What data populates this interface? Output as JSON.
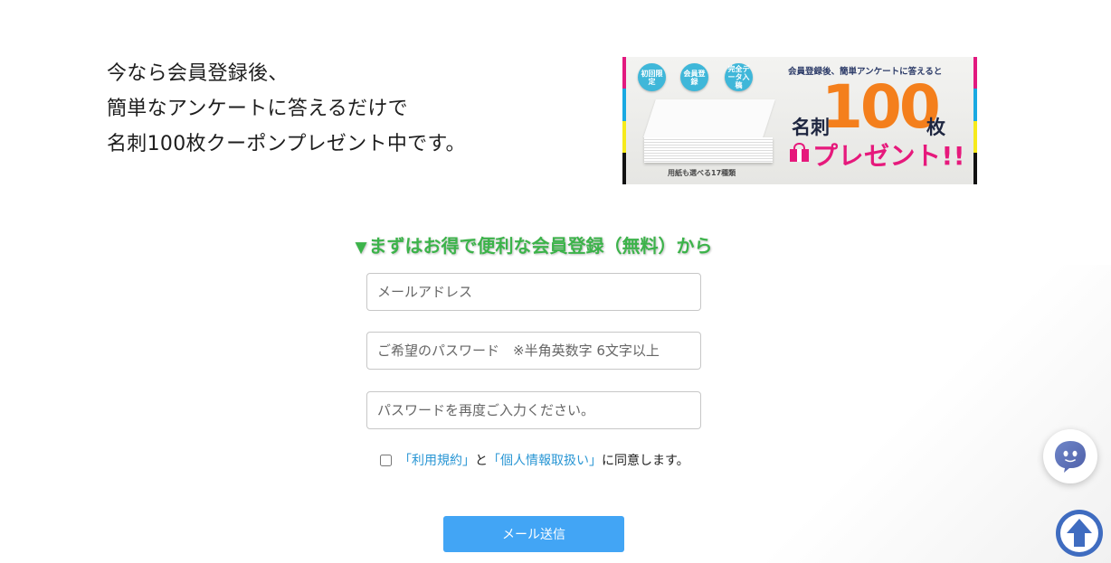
{
  "intro": {
    "lines": [
      "今なら会員登録後、",
      "簡単なアンケートに答えるだけで",
      "名刺100枚クーポンプレゼント中です。"
    ]
  },
  "banner": {
    "badges": [
      "初回限定",
      "会員登録",
      "完全データ入稿"
    ],
    "headline": "会員登録後、簡単アンケートに答えると",
    "meishi": "名刺",
    "count": "100",
    "unit": "枚",
    "present": "プレゼント!!",
    "paper_note": "用紙も選べる17種類",
    "colors": {
      "magenta": "#e2197f",
      "cyan": "#19a9e2",
      "yellow": "#f6ea1b",
      "black": "#111111",
      "orange": "#f47f1c",
      "pink": "#e6197c"
    }
  },
  "heading": {
    "marker": "▼",
    "text": "まずはお得で便利な会員登録（無料）から",
    "color": "#3cb34a"
  },
  "form": {
    "email": {
      "placeholder": "メールアドレス",
      "value": ""
    },
    "password": {
      "placeholder": "ご希望のパスワード　※半角英数字 6文字以上",
      "value": ""
    },
    "password_confirm": {
      "placeholder": "パスワードを再度ご入力ください。",
      "value": ""
    },
    "agree": {
      "checked": false,
      "terms_link": "「利用規約」",
      "connector": "と",
      "privacy_link": "「個人情報取扱い」",
      "suffix": "に同意します。"
    },
    "submit_label": "メール送信",
    "submit_color": "#42a5f5"
  },
  "widgets": {
    "chat_icon": "chat-bot-icon",
    "top_icon": "arrow-up-icon",
    "top_color": "#3f6cc0"
  }
}
